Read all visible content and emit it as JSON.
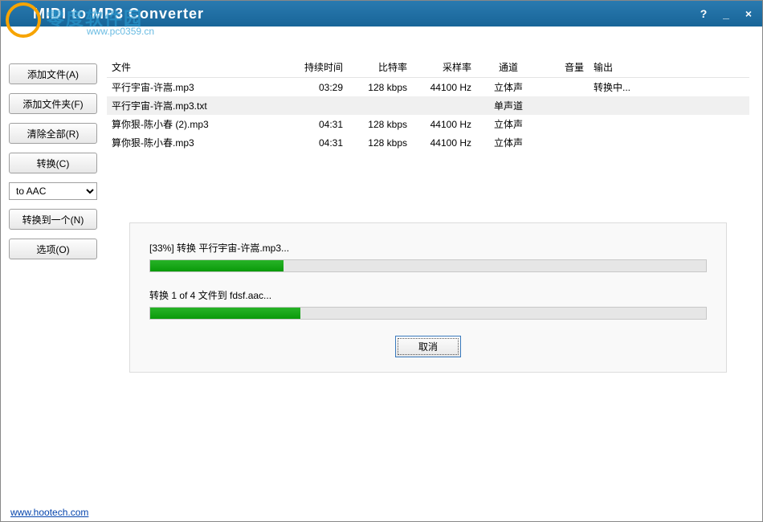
{
  "window": {
    "title": "MIDI to MP3 Converter",
    "help": "?",
    "min": "_",
    "close": "×"
  },
  "watermark": {
    "text": "零度软件园",
    "url": "www.pc0359.cn"
  },
  "sidebar": {
    "add_file": "添加文件(A)",
    "add_folder": "添加文件夹(F)",
    "clear_all": "清除全部(R)",
    "convert": "转换(C)",
    "format_selected": "to AAC",
    "convert_to_one": "转换到一个(N)",
    "options": "选项(O)"
  },
  "table": {
    "headers": {
      "file": "文件",
      "duration": "持续时间",
      "bitrate": "比特率",
      "samplerate": "采样率",
      "channels": "通道",
      "volume": "音量",
      "output": "输出"
    },
    "rows": [
      {
        "file": "平行宇宙-许嵩.mp3",
        "duration": "03:29",
        "bitrate": "128 kbps",
        "samplerate": "44100 Hz",
        "channels": "立体声",
        "volume": "",
        "output": "转换中...",
        "sel": false
      },
      {
        "file": "平行宇宙-许嵩.mp3.txt",
        "duration": "",
        "bitrate": "",
        "samplerate": "",
        "channels": "单声道",
        "volume": "",
        "output": "",
        "sel": true
      },
      {
        "file": "算你狠-陈小春 (2).mp3",
        "duration": "04:31",
        "bitrate": "128 kbps",
        "samplerate": "44100 Hz",
        "channels": "立体声",
        "volume": "",
        "output": "",
        "sel": false
      },
      {
        "file": "算你狠-陈小春.mp3",
        "duration": "04:31",
        "bitrate": "128 kbps",
        "samplerate": "44100 Hz",
        "channels": "立体声",
        "volume": "",
        "output": "",
        "sel": false
      }
    ]
  },
  "progress": {
    "line1": "[33%] 转换 平行宇宙-许嵩.mp3...",
    "pct1": 24,
    "line2": "转换 1 of 4 文件到 fdsf.aac...",
    "pct2": 27,
    "cancel": "取消"
  },
  "footer": {
    "link": "www.hootech.com"
  }
}
